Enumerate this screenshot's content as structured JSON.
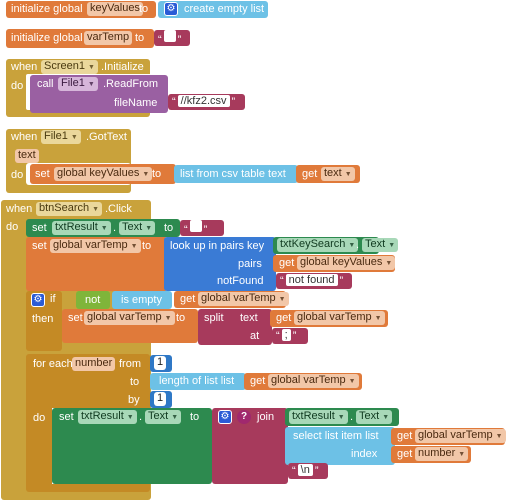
{
  "blocks": {
    "init_keyvalues": {
      "initialize_global": "initialize global",
      "name": "keyValues",
      "to": "to",
      "create_empty_list": "create empty list"
    },
    "init_vartemp": {
      "initialize_global": "initialize global",
      "name": "varTemp",
      "to": "to",
      "text_value": ""
    },
    "screen_init": {
      "when": "when",
      "component": "Screen1",
      "event": ".Initialize",
      "do": "do",
      "call": "call",
      "call_component": "File1",
      "method": ".ReadFrom",
      "param_label": "fileName",
      "file_name": "//kfz2.csv"
    },
    "file_gottext": {
      "when": "when",
      "component": "File1",
      "event": ".GotText",
      "param": "text",
      "do": "do",
      "set": "set",
      "target": "global keyValues",
      "to": "to",
      "list_from_csv": "list from csv table  text",
      "get": "get",
      "get_arg": "text"
    },
    "btnsearch_click": {
      "when": "when",
      "component": "btnSearch",
      "event": ".Click",
      "do": "do",
      "set1": {
        "set": "set",
        "component": "txtResult",
        "prop": "Text",
        "to": "to",
        "text_value": ""
      },
      "set2": {
        "set": "set",
        "target": "global varTemp",
        "to": "to",
        "lookup": "look up in pairs  key",
        "key_component": "txtKeySearch",
        "key_prop": "Text",
        "pairs_label": "pairs",
        "get": "get",
        "pairs_value": "global keyValues",
        "notfound_label": "notFound",
        "notfound_value": "not found"
      },
      "if_block": {
        "if": "if",
        "not": "not",
        "is_empty": "is empty",
        "get": "get",
        "get_value": "global varTemp",
        "then": "then",
        "set": "set",
        "target": "global varTemp",
        "to": "to",
        "split": "split",
        "text_label": "text",
        "text_value": "global varTemp",
        "at_label": "at",
        "at_value": ";"
      },
      "foreach": {
        "for_each": "for each",
        "var": "number",
        "from": "from",
        "from_value": "1",
        "to": "to",
        "length_of_list": "length of list  list",
        "get": "get",
        "list_value": "global varTemp",
        "by": "by",
        "by_value": "1",
        "do": "do"
      },
      "set3": {
        "set": "set",
        "component": "txtResult",
        "prop": "Text",
        "to": "to",
        "join": "join",
        "join_component": "txtResult",
        "join_prop": "Text",
        "select_item": "select list item  list",
        "get": "get",
        "select_list": "global varTemp",
        "index_label": "index",
        "index_value": "number",
        "newline": "\\n"
      }
    }
  }
}
